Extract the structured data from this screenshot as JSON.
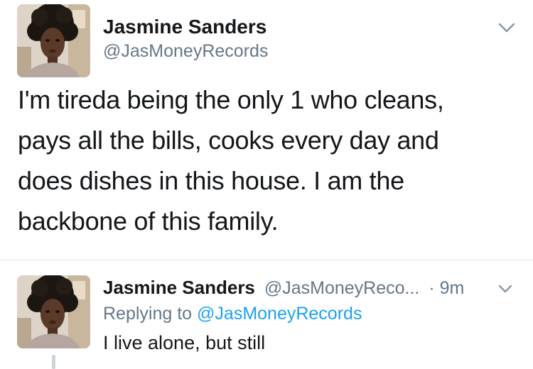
{
  "main_tweet": {
    "author_name": "Jasmine Sanders",
    "author_handle": "@JasMoneyRecords",
    "text_lines": [
      "I'm tireda being the only 1 who cleans,",
      "pays all the bills, cooks every day and",
      "does dishes in this house. I am the",
      "backbone of this family."
    ],
    "menu_icon": "chevron-down-icon"
  },
  "reply_tweet": {
    "author_name": "Jasmine Sanders",
    "author_handle": "@JasMoneyReco...",
    "separator": "·",
    "time": "9m",
    "replying_prefix": "Replying to",
    "replying_mention": "@JasMoneyRecords",
    "text": "I live alone, but still",
    "menu_icon": "chevron-down-icon"
  },
  "colors": {
    "text_primary": "#14171a",
    "text_secondary": "#657786",
    "mention": "#1da1f2",
    "divider": "#e1e8ed"
  }
}
